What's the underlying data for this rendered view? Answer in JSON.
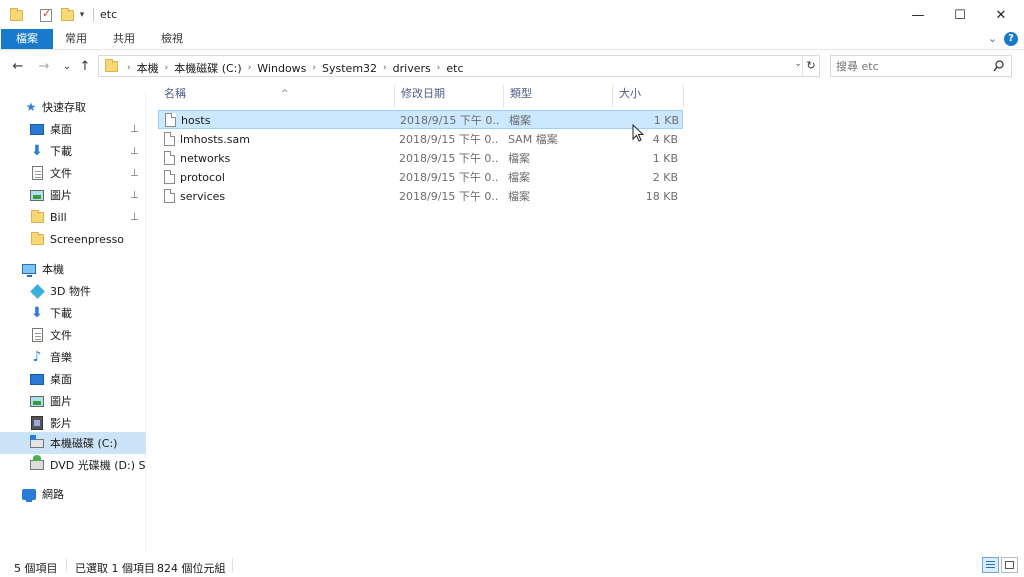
{
  "window": {
    "title": "etc",
    "minimize": "—",
    "maximize": "☐",
    "close": "✕"
  },
  "ribbon": {
    "tabs": [
      "檔案",
      "常用",
      "共用",
      "檢視"
    ],
    "expand": "⌄",
    "help": "?"
  },
  "address": {
    "back": "←",
    "forward": "→",
    "recent": "⌄",
    "up": "↑",
    "crumbs": [
      "本機",
      "本機磁碟 (C:)",
      "Windows",
      "System32",
      "drivers",
      "etc"
    ],
    "separator": "›",
    "dropdown": "⌄",
    "refresh": "↻"
  },
  "search": {
    "placeholder": "搜尋 etc"
  },
  "navpane": {
    "quick_access": "快速存取",
    "quick_items": [
      {
        "label": "桌面",
        "icon": "desktop-icon",
        "pinned": true
      },
      {
        "label": "下載",
        "icon": "download-icon",
        "pinned": true
      },
      {
        "label": "文件",
        "icon": "documents-icon",
        "pinned": true
      },
      {
        "label": "圖片",
        "icon": "pictures-icon",
        "pinned": true
      },
      {
        "label": "Bill",
        "icon": "folder-icon",
        "pinned": true
      },
      {
        "label": "Screenpresso",
        "icon": "folder-icon",
        "pinned": false
      }
    ],
    "this_pc": "本機",
    "pc_items": [
      {
        "label": "3D 物件",
        "icon": "3d-objects-icon"
      },
      {
        "label": "下載",
        "icon": "download-icon"
      },
      {
        "label": "文件",
        "icon": "documents-icon"
      },
      {
        "label": "音樂",
        "icon": "music-icon"
      },
      {
        "label": "桌面",
        "icon": "desktop-icon"
      },
      {
        "label": "圖片",
        "icon": "pictures-icon"
      },
      {
        "label": "影片",
        "icon": "videos-icon"
      },
      {
        "label": "本機磁碟 (C:)",
        "icon": "drive-icon",
        "selected": true
      },
      {
        "label": "DVD 光碟機 (D:) SS",
        "icon": "dvd-icon"
      }
    ],
    "network": "網路",
    "pin_glyph": "📌"
  },
  "columns": {
    "name": "名稱",
    "date": "修改日期",
    "type": "類型",
    "size": "大小",
    "sort_glyph": "^"
  },
  "files": [
    {
      "name": "hosts",
      "date": "2018/9/15 下午 0...",
      "type": "檔案",
      "size": "1 KB",
      "selected": true
    },
    {
      "name": "lmhosts.sam",
      "date": "2018/9/15 下午 0...",
      "type": "SAM 檔案",
      "size": "4 KB"
    },
    {
      "name": "networks",
      "date": "2018/9/15 下午 0...",
      "type": "檔案",
      "size": "1 KB"
    },
    {
      "name": "protocol",
      "date": "2018/9/15 下午 0...",
      "type": "檔案",
      "size": "2 KB"
    },
    {
      "name": "services",
      "date": "2018/9/15 下午 0...",
      "type": "檔案",
      "size": "18 KB"
    }
  ],
  "status": {
    "item_count": "5 個項目",
    "selection": "已選取 1 個項目",
    "selection_size": "824 個位元組"
  },
  "colors": {
    "accent": "#1979ca",
    "selection": "#cce8ff",
    "nav_selected": "#cce4f7"
  }
}
